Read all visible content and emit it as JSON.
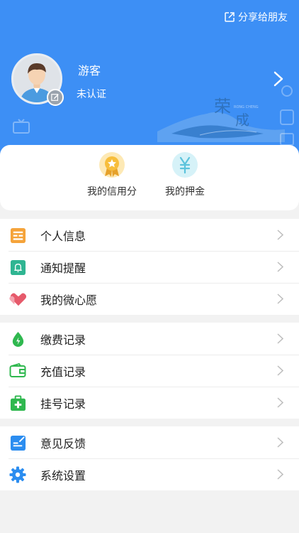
{
  "header": {
    "share_label": "分享给朋友",
    "user_name": "游客",
    "user_status": "未认证",
    "deco_text_1": "荣",
    "deco_text_2": "成",
    "deco_text_en": "RONG CHENG",
    "bg_color": "#3d8ff5"
  },
  "cards": [
    {
      "label": "我的信用分",
      "icon": "medal-icon"
    },
    {
      "label": "我的押金",
      "icon": "yuan-icon"
    }
  ],
  "menu_groups": [
    [
      {
        "label": "个人信息",
        "icon": "id-card-icon",
        "color": "#f5a33a"
      },
      {
        "label": "通知提醒",
        "icon": "bell-icon",
        "color": "#2fb592"
      },
      {
        "label": "我的微心愿",
        "icon": "hearts-icon",
        "color": "#e65a6b"
      }
    ],
    [
      {
        "label": "缴费记录",
        "icon": "drop-icon",
        "color": "#2fb84f"
      },
      {
        "label": "充值记录",
        "icon": "wallet-icon",
        "color": "#2fb84f"
      },
      {
        "label": "挂号记录",
        "icon": "medical-kit-icon",
        "color": "#2fb84f"
      }
    ],
    [
      {
        "label": "意见反馈",
        "icon": "feedback-icon",
        "color": "#2b8df0"
      },
      {
        "label": "系统设置",
        "icon": "gear-icon",
        "color": "#2b8df0"
      }
    ]
  ]
}
